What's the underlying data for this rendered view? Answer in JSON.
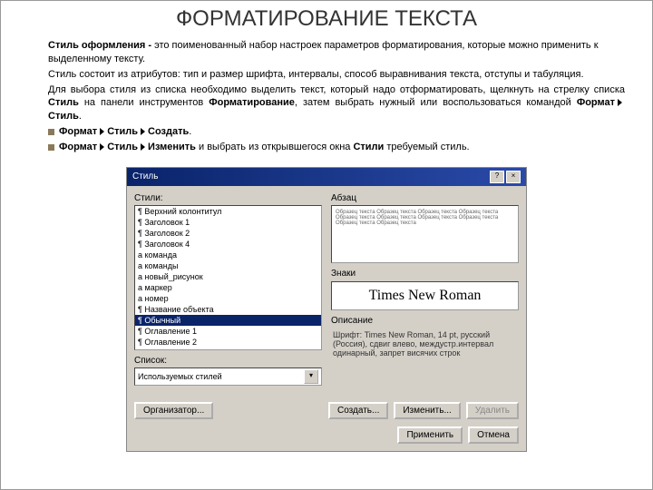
{
  "title": "ФОРМАТИРОВАНИЕ ТЕКСТА",
  "para": {
    "p1a": "Стиль оформления - ",
    "p1b": "это поименованный набор настроек параметров форматирования, которые можно применить к выделенному тексту.",
    "p2": "Стиль состоит из атрибутов: тип и размер шрифта, интервалы, способ выравнивания текста, отступы и табуляция.",
    "p3a": "Для выбора стиля из списка необходимо выделить текст, который надо отформатировать, щелкнуть на стрелку списка ",
    "p3b": "Стиль",
    "p3c": " на панели инструментов ",
    "p3d": "Форматирование",
    "p3e": ", затем выбрать нужный или воспользоваться командой ",
    "p3f": "Формат",
    "p3g": "Стиль",
    "p4a": "Формат",
    "p4b": "Стиль",
    "p4c": "Создать",
    "p5a": "Формат",
    "p5b": "Стиль",
    "p5c": "Изменить",
    "p5d": " и выбрать из открывшегося  окна ",
    "p5e": "Стили",
    "p5f": " требуемый стиль."
  },
  "dialog": {
    "title": "Стиль",
    "labels": {
      "styles": "Стили:",
      "paragraph": "Абзац",
      "chars": "Знаки",
      "desc": "Описание",
      "list": "Список:"
    },
    "styles_list": [
      "¶ Верхний колонтитул",
      "¶ Заголовок 1",
      "¶ Заголовок 2",
      "¶ Заголовок 4",
      "a команда",
      "a команды",
      "a новый_рисунок",
      "a маркер",
      "a номер",
      "¶ Название объекта",
      "¶ Обычный",
      "¶ Оглавление 1",
      "¶ Оглавление 2"
    ],
    "selected_index": 10,
    "preview_text": "Образец текста Образец текста Образец текста Образец текста Образец текста Образец текста Образец текста Образец текста Образец текста Образец текста",
    "font_preview": "Times New Roman",
    "description": "Шрифт: Times New Roman, 14 pt, русский (Россия), сдвиг влево, междустр.интервал одинарный, запрет висячих строк",
    "combo_value": "Используемых стилей",
    "buttons": {
      "organizer": "Организатор...",
      "create": "Создать...",
      "modify": "Изменить...",
      "delete": "Удалить",
      "apply": "Применить",
      "cancel": "Отмена"
    }
  }
}
